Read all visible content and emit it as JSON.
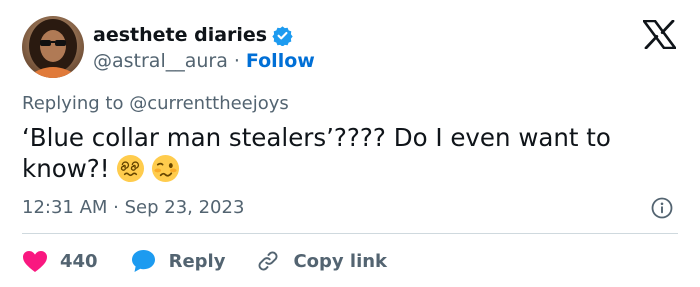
{
  "colors": {
    "accent": "#006fd6",
    "like": "#f91880",
    "reply": "#1d9bf0",
    "verified": "#1d9bf0",
    "secondary_text": "#536471",
    "primary_text": "#0f1419"
  },
  "author": {
    "display_name": "aesthete diaries",
    "handle": "@astral__aura",
    "separator": "·",
    "follow_label": "Follow",
    "verified_icon": "verified-badge-icon",
    "avatar": "profile-photo"
  },
  "platform_icon": "x-logo-icon",
  "reply_context": "Replying to @currenttheejoys",
  "tweet": {
    "text": "‘Blue collar man stealers’???? Do I even want to know?!",
    "emojis": [
      "dizzy-face-emoji",
      "woozy-face-emoji"
    ]
  },
  "timestamp": "12:31 AM · Sep 23, 2023",
  "info_icon": "info-icon",
  "actions": {
    "like_count": "440",
    "like_icon": "heart-icon",
    "reply_label": "Reply",
    "reply_icon": "speech-bubble-icon",
    "copy_label": "Copy link",
    "copy_icon": "link-icon"
  }
}
